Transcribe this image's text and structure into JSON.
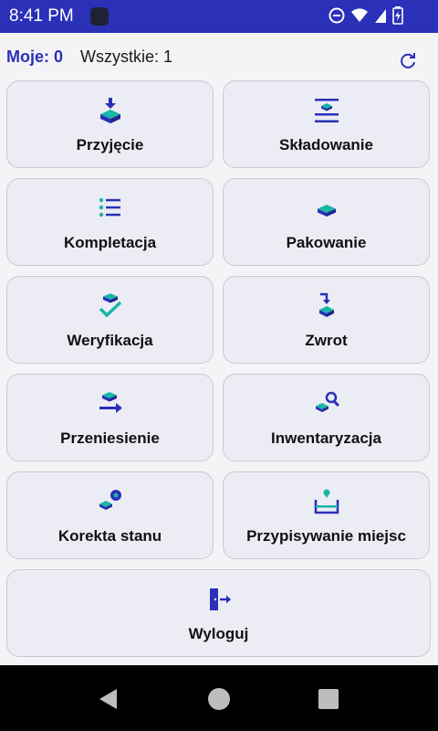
{
  "status": {
    "time": "8:41 PM"
  },
  "header": {
    "mine": "Moje: 0",
    "all": "Wszystkie: 1"
  },
  "tiles": [
    {
      "label": "Przyjęcie",
      "icon": "inbound-box-icon"
    },
    {
      "label": "Składowanie",
      "icon": "storage-shelf-icon"
    },
    {
      "label": "Kompletacja",
      "icon": "checklist-icon"
    },
    {
      "label": "Pakowanie",
      "icon": "package-icon"
    },
    {
      "label": "Weryfikacja",
      "icon": "verify-check-icon"
    },
    {
      "label": "Zwrot",
      "icon": "return-arrow-icon"
    },
    {
      "label": "Przeniesienie",
      "icon": "transfer-arrow-icon"
    },
    {
      "label": "Inwentaryzacja",
      "icon": "inventory-search-icon"
    },
    {
      "label": "Korekta stanu",
      "icon": "stock-correction-icon"
    },
    {
      "label": "Przypisywanie miejsc",
      "icon": "location-pin-icon"
    },
    {
      "label": "Wyloguj",
      "icon": "logout-icon"
    }
  ],
  "colors": {
    "statusbar": "#2a30b8",
    "accent": "#2a30b8",
    "teal": "#17b6a7",
    "navbar": "#000000"
  }
}
